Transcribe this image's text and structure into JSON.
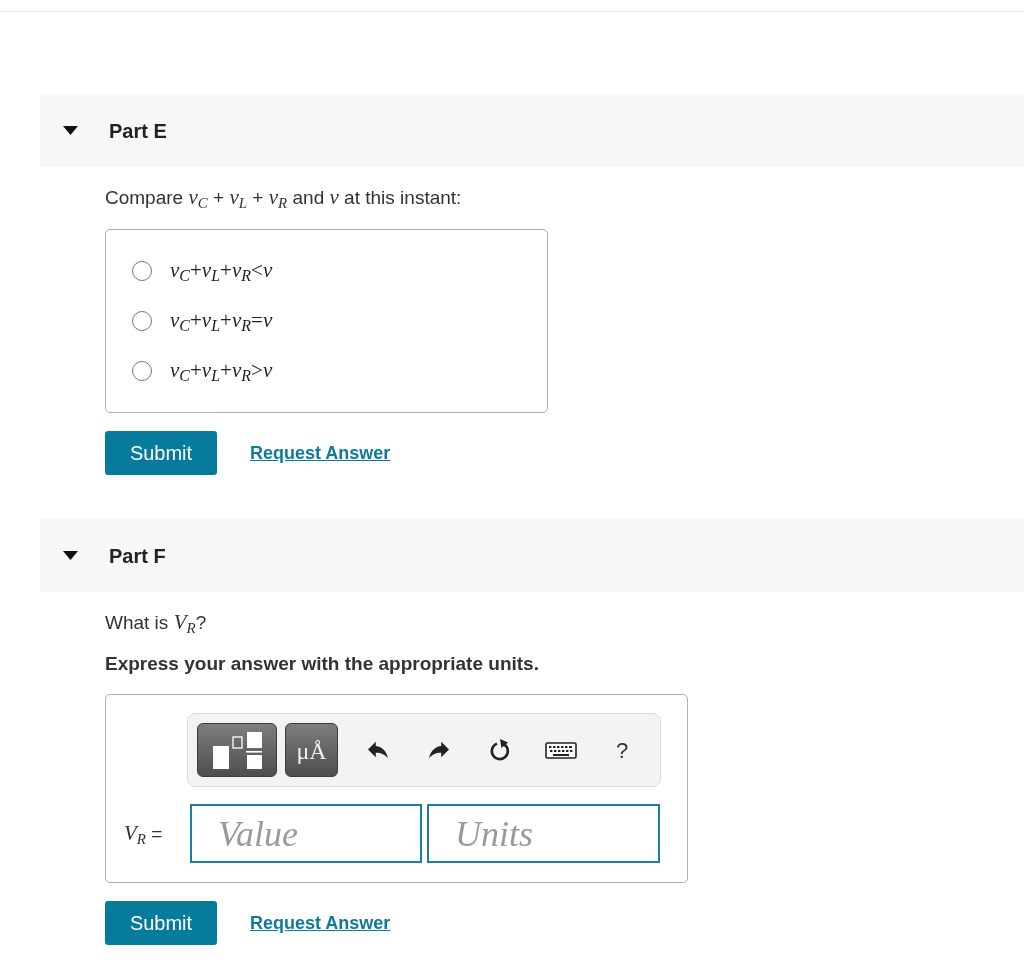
{
  "parts": [
    {
      "title": "Part E",
      "expanded": true,
      "prompt": "Compare *v*$_{C}$ + *v*$_{L}$ + *v*$_{R}$ and *v* at this instant:",
      "options": [
        {
          "label": "*v*$_{C}$+*v*$_{L}$+*v*$_{R}$<*v*",
          "selected": false
        },
        {
          "label": "*v*$_{C}$+*v*$_{L}$+*v*$_{R}$=*v*",
          "selected": false
        },
        {
          "label": "*v*$_{C}$+*v*$_{L}$+*v*$_{R}$>*v*",
          "selected": false
        }
      ],
      "buttons": {
        "submit": "Submit",
        "request_answer": "Request Answer"
      }
    },
    {
      "title": "Part F",
      "expanded": true,
      "prompt": "What is *V*$_{R}$?",
      "instruction": "Express your answer with the appropriate units.",
      "answer": {
        "toolbar": [
          {
            "kind": "templates"
          },
          {
            "kind": "units",
            "label": "μÅ"
          },
          {
            "kind": "undo"
          },
          {
            "kind": "redo"
          },
          {
            "kind": "reset"
          },
          {
            "kind": "keyboard"
          },
          {
            "kind": "help",
            "label": "?"
          }
        ],
        "label": "*V*$_{R}$ =",
        "value": {
          "placeholder": "Value"
        },
        "units": {
          "placeholder": "Units"
        }
      },
      "buttons": {
        "submit": "Submit",
        "request_answer": "Request Answer"
      }
    }
  ]
}
